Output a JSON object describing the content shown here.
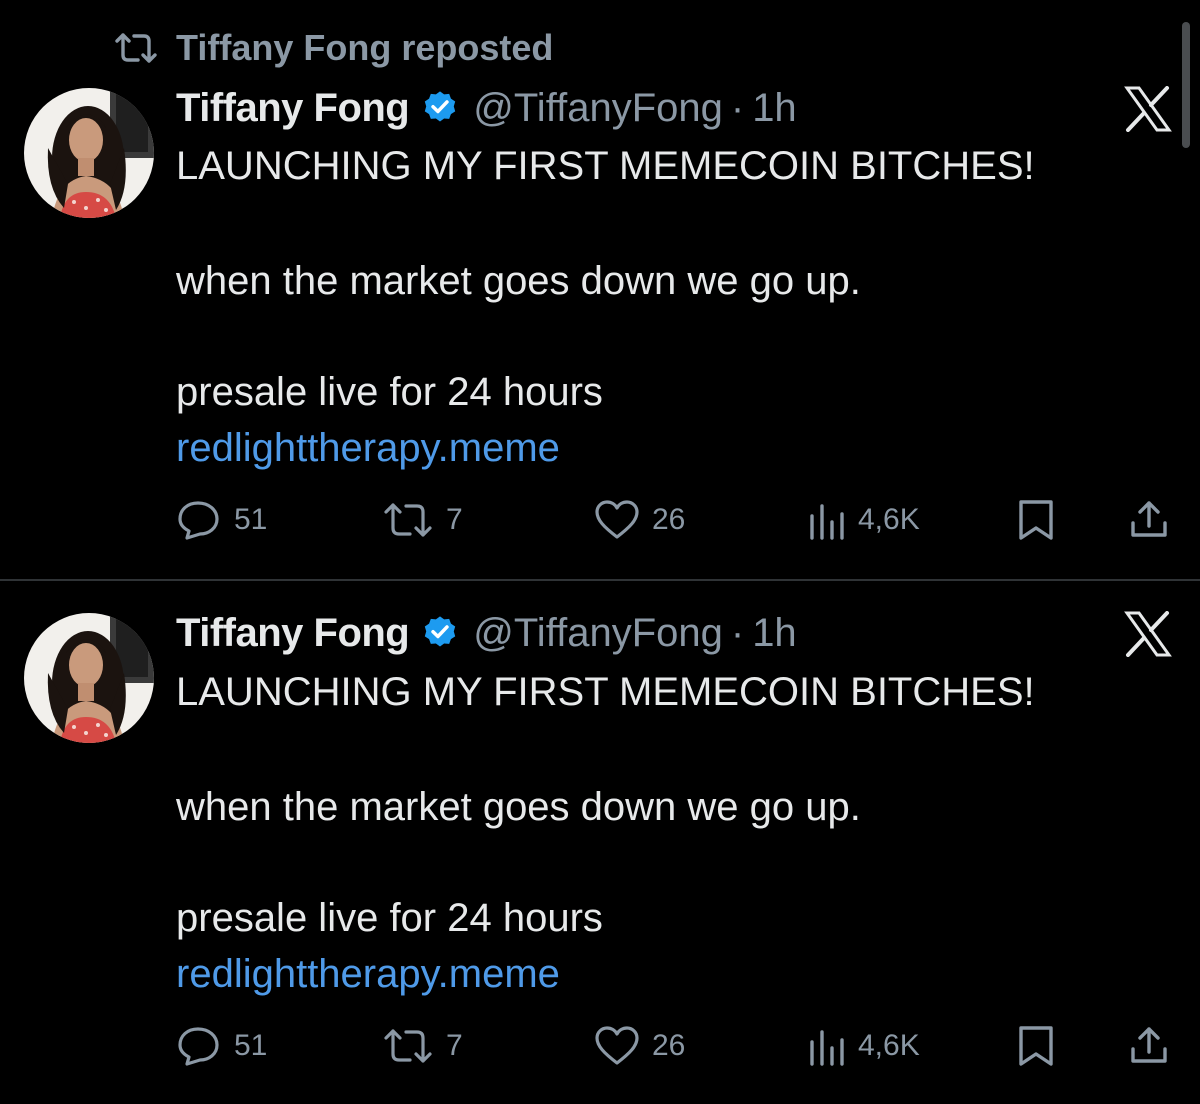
{
  "repost": {
    "label": "Tiffany Fong reposted"
  },
  "tweets": [
    {
      "name": "Tiffany Fong",
      "handle": "@TiffanyFong",
      "separator": "·",
      "time": "1h",
      "lines": [
        "LAUNCHING MY FIRST MEMECOIN BITCHES!",
        "when the market goes down we go up.",
        "presale live for 24 hours",
        "redlighttherapy.meme"
      ],
      "replies": "51",
      "retweets": "7",
      "likes": "26",
      "views": "4,6K"
    },
    {
      "name": "Tiffany Fong",
      "handle": "@TiffanyFong",
      "separator": "·",
      "time": "1h",
      "lines": [
        "LAUNCHING MY FIRST MEMECOIN BITCHES!",
        "when the market goes down we go up.",
        "presale live for 24 hours",
        "redlighttherapy.meme"
      ],
      "replies": "51",
      "retweets": "7",
      "likes": "26",
      "views": "4,6K"
    }
  ],
  "icons": {
    "repost": "repost-icon",
    "verified": "verified-badge-icon",
    "brand": "x-logo-icon",
    "reply": "reply-icon",
    "retweet": "retweet-icon",
    "like": "heart-icon",
    "views": "views-icon",
    "bookmark": "bookmark-icon",
    "share": "share-icon"
  },
  "colors": {
    "background": "#000000",
    "text": "#e7e9ea",
    "secondary": "#8b98a5",
    "link": "#4f9ae8",
    "verified": "#1d9bf0",
    "divider": "#2f3336"
  }
}
